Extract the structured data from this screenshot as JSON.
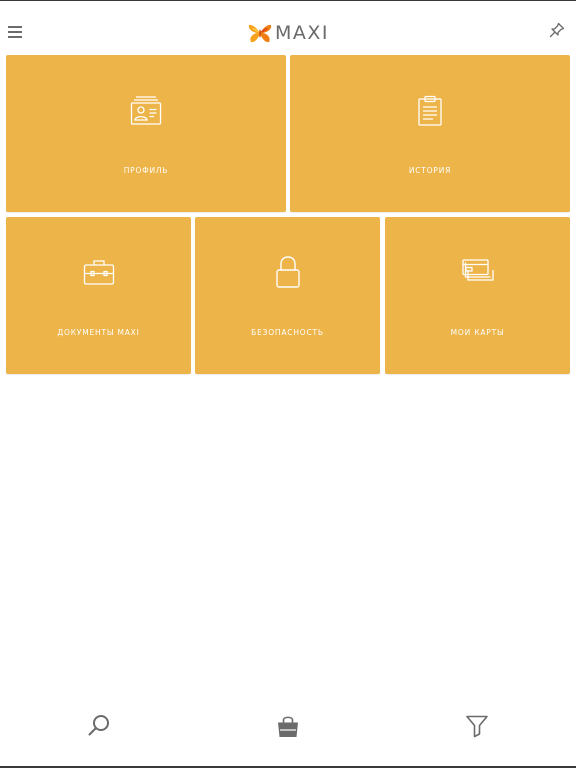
{
  "app": {
    "logo_text": "MAXI"
  },
  "header": {
    "menu_icon": "hamburger-menu-icon",
    "action_icon": "pin-icon"
  },
  "tiles": [
    {
      "label": "ПРОФИЛЬ",
      "icon": "id-card-icon"
    },
    {
      "label": "ИСТОРИЯ",
      "icon": "clipboard-list-icon"
    },
    {
      "label": "ДОКУМЕНТЫ MAXI",
      "icon": "briefcase-icon"
    },
    {
      "label": "БЕЗОПАСНОСТЬ",
      "icon": "padlock-icon"
    },
    {
      "label": "МОИ КАРТЫ",
      "icon": "cards-icon"
    }
  ],
  "tabbar": {
    "tabs": [
      {
        "icon": "search-icon"
      },
      {
        "icon": "shopping-bag-icon"
      },
      {
        "icon": "filter-icon"
      }
    ]
  },
  "colors": {
    "tile_bg": "#ecb449",
    "icon_gray": "#6b6b6b",
    "logo_orange": "#f39a1e"
  }
}
